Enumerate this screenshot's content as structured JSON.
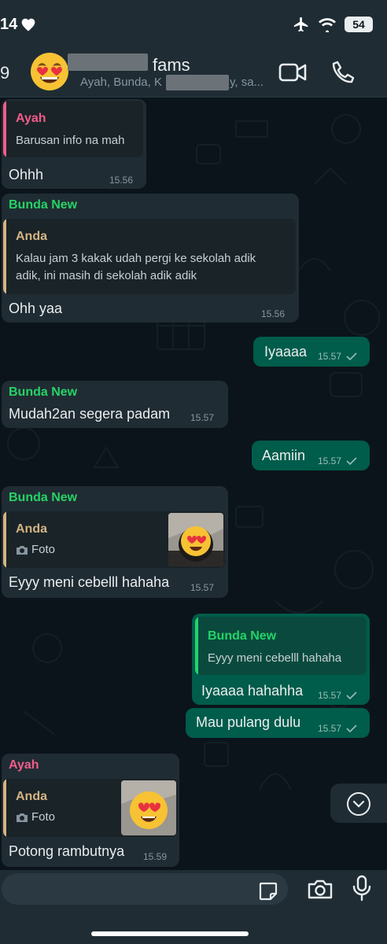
{
  "status_bar": {
    "time": "14",
    "battery": "54"
  },
  "header": {
    "back_count": "9",
    "title_suffix": "fams",
    "members_prefix": "Ayah, Bunda, K",
    "members_suffix": "y, sa..."
  },
  "messages": [
    {
      "quote_name": "Ayah",
      "quote_text": "Barusan info na mah",
      "text": "Ohhh",
      "time": "15.56"
    },
    {
      "sender": "Bunda New",
      "quote_name": "Anda",
      "quote_line1": "Kalau jam 3 kakak udah pergi ke sekolah adik",
      "quote_line2": "adik, ini masih di sekolah adik adik",
      "text": "Ohh yaa",
      "time": "15.56"
    },
    {
      "text": "Iyaaaa",
      "time": "15.57"
    },
    {
      "sender": "Bunda New",
      "text": "Mudah2an segera padam",
      "time": "15.57"
    },
    {
      "text": "Aamiin",
      "time": "15.57"
    },
    {
      "sender": "Bunda New",
      "quote_name": "Anda",
      "quote_media": "Foto",
      "text": "Eyyy meni cebelll hahaha",
      "time": "15.57"
    },
    {
      "quote_name": "Bunda New",
      "quote_text": "Eyyy meni cebelll hahaha",
      "text": "Iyaaaa hahahha",
      "time": "15.57"
    },
    {
      "text": "Mau pulang dulu",
      "time": "15.57"
    },
    {
      "sender": "Ayah",
      "quote_name": "Anda",
      "quote_media": "Foto",
      "text": "Potong rambutnya",
      "time": "15.59"
    }
  ],
  "icons": {
    "heart": "heart-icon",
    "airplane": "airplane-icon",
    "wifi": "wifi-icon",
    "video": "video-call-icon",
    "call": "phone-icon",
    "camera": "camera-icon",
    "mic": "microphone-icon",
    "sticker": "sticker-icon",
    "scroll": "chevron-down-icon"
  },
  "colors": {
    "incoming": "#202c33",
    "outgoing": "#005c4b",
    "sender_green": "#25d366",
    "sender_pink": "#f15c8b",
    "quote_bar_you": "#d4b483",
    "quote_bar_green": "#25d366"
  }
}
